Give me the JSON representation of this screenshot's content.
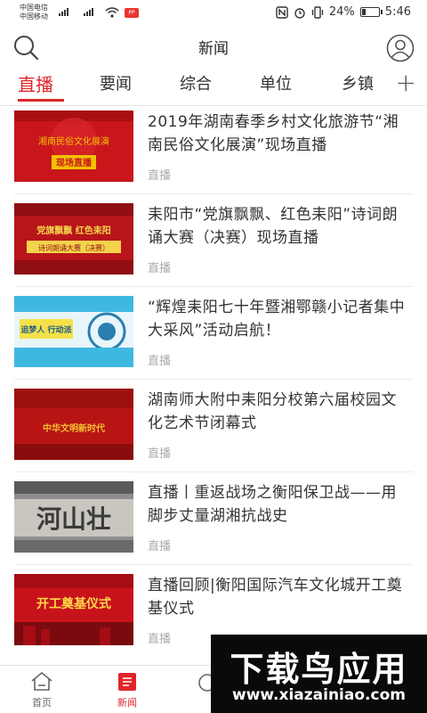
{
  "status_bar": {
    "carrier_1": "中国电信",
    "carrier_2": "中国移动",
    "battery_percent": "24%",
    "battery_level": 0.24,
    "time": "5:46"
  },
  "header": {
    "title": "新闻",
    "search_icon": "search-icon",
    "user_icon": "user-icon"
  },
  "tabs": [
    {
      "label": "直播",
      "active": true
    },
    {
      "label": "要闻",
      "active": false
    },
    {
      "label": "综合",
      "active": false
    },
    {
      "label": "单位",
      "active": false
    },
    {
      "label": "乡镇",
      "active": false
    }
  ],
  "tabs_add_label": "+",
  "news": [
    {
      "headline": "2019年湖南春季乡村文化旅游节“湘南民俗文化展演”现场直播",
      "tag": "直播",
      "thumb_text": [
        "湘南民俗文化展演",
        "现场直播"
      ],
      "thumb_colors": [
        "#c8161b",
        "#f2c200"
      ]
    },
    {
      "headline": "耒阳市“党旗飘飘、红色耒阳”诗词朗诵大赛（决赛）现场直播",
      "tag": "直播",
      "thumb_text": [
        "党旗飘飘 红色耒阳",
        "诗词朗诵大赛（决赛）"
      ],
      "thumb_colors": [
        "#b8151a",
        "#f5d34b"
      ]
    },
    {
      "headline": "“辉煌耒阳七十年暨湘鄂赣小记者集中大采风”活动启航！",
      "tag": "直播",
      "thumb_text": [
        "追梦人 行动派"
      ],
      "thumb_colors": [
        "#3fb8e0",
        "#f5e14a"
      ]
    },
    {
      "headline": "湖南师大附中耒阳分校第六届校园文化艺术节闭幕式",
      "tag": "直播",
      "thumb_text": [
        "中华文明新时代"
      ],
      "thumb_colors": [
        "#b81414",
        "#f5c030"
      ]
    },
    {
      "headline": "直播丨重返战场之衡阳保卫战——用脚步丈量湖湘抗战史",
      "tag": "直播",
      "thumb_text": [
        "河山壮"
      ],
      "thumb_colors": [
        "#9a9a9a",
        "#4a4a4a"
      ]
    },
    {
      "headline": "直播回顾|衡阳国际汽车文化城开工奠基仪式",
      "tag": "直播",
      "thumb_text": [
        "开工奠基仪式"
      ],
      "thumb_colors": [
        "#c8121b",
        "#ffd94a"
      ]
    }
  ],
  "bottom_nav": [
    {
      "label": "首页",
      "icon": "home-icon",
      "active": false
    },
    {
      "label": "新闻",
      "icon": "news-icon",
      "active": true
    }
  ],
  "watermark": {
    "title": "下载鸟应用",
    "url": "www.xiazainiao.com"
  },
  "colors": {
    "accent": "#e0262a",
    "tag_gray": "#aaaaaa",
    "divider": "#ececec"
  }
}
